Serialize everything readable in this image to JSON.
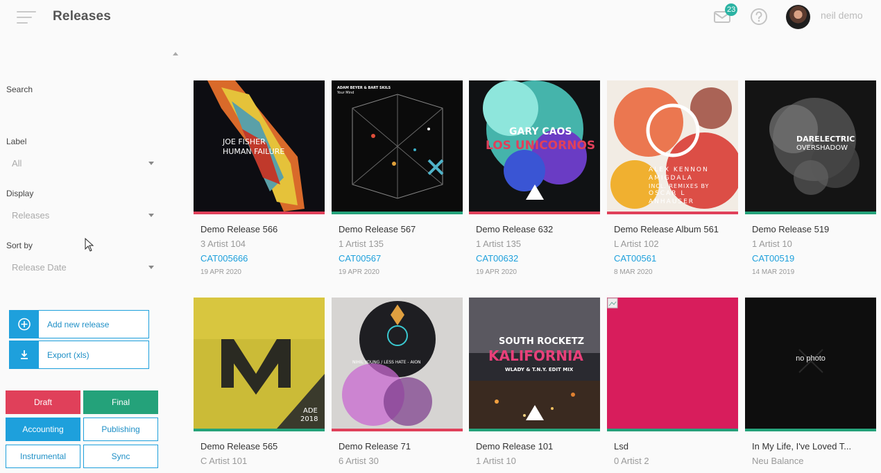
{
  "header": {
    "title": "Releases",
    "notification_count": "23",
    "username": "neil demo"
  },
  "sidebar": {
    "search_label": "Search",
    "label_label": "Label",
    "label_value": "All",
    "display_label": "Display",
    "display_value": "Releases",
    "sort_label": "Sort by",
    "sort_value": "Release Date",
    "add_release": "Add new release",
    "export": "Export (xls)",
    "tags": {
      "draft": "Draft",
      "final": "Final",
      "accounting": "Accounting",
      "publishing": "Publishing",
      "instrumental": "Instrumental",
      "sync": "Sync"
    }
  },
  "colors": {
    "accent": "#1ea0dc",
    "red": "#e0405a",
    "green": "#24a27a",
    "badge": "#2bb3a3"
  },
  "releases": [
    {
      "title": "Demo Release 566",
      "artist": "3 Artist 104",
      "catalog": "CAT005666",
      "date": "19 APR 2020",
      "status": "red",
      "cover_text": [
        "JOE FISHER",
        "HUMAN FAILURE"
      ]
    },
    {
      "title": "Demo Release 567",
      "artist": "1 Artist 135",
      "catalog": "CAT00567",
      "date": "19 APR 2020",
      "status": "green",
      "cover_text": [
        "ADAM BEYER & BART SKILS",
        "Your Mind"
      ]
    },
    {
      "title": "Demo Release 632",
      "artist": "1 Artist 135",
      "catalog": "CAT00632",
      "date": "19 APR 2020",
      "status": "red",
      "cover_text": [
        "GARY CAOS",
        "LOS UNICORNOS"
      ]
    },
    {
      "title": "Demo Release Album 561",
      "artist": "L Artist 102",
      "catalog": "CAT00561",
      "date": "8 MAR 2020",
      "status": "red",
      "cover_text": [
        "ALEX KENNON",
        "AMIGDALA",
        "INCL. REMIXES BY",
        "OSCAR L",
        "ANHAUSER"
      ]
    },
    {
      "title": "Demo Release 519",
      "artist": "1 Artist 10",
      "catalog": "CAT00519",
      "date": "14 MAR 2019",
      "status": "green",
      "cover_text": [
        "DARELECTRIC",
        "OVERSHADOW"
      ]
    },
    {
      "title": "Demo Release 565",
      "artist": "C Artist 101",
      "catalog": "",
      "date": "",
      "status": "green",
      "cover_text": [
        "ADE",
        "2018"
      ]
    },
    {
      "title": "Demo Release 71",
      "artist": "6 Artist 30",
      "catalog": "",
      "date": "",
      "status": "red",
      "cover_text": [
        "NIHIL YOUNG / LESS HATE - AION"
      ]
    },
    {
      "title": "Demo Release 101",
      "artist": "1 Artist 10",
      "catalog": "",
      "date": "",
      "status": "green",
      "cover_text": [
        "SOUTH ROCKETZ",
        "KALIFORNIA",
        "WLADY & T.N.Y. EDIT MIX"
      ]
    },
    {
      "title": "Lsd",
      "artist": "0 Artist 2",
      "catalog": "",
      "date": "",
      "status": "green",
      "cover_text": []
    },
    {
      "title": "In My Life, I've Loved T...",
      "artist": "Neu Balance",
      "catalog": "",
      "date": "",
      "status": "green",
      "cover_text": [
        "no photo"
      ]
    }
  ]
}
